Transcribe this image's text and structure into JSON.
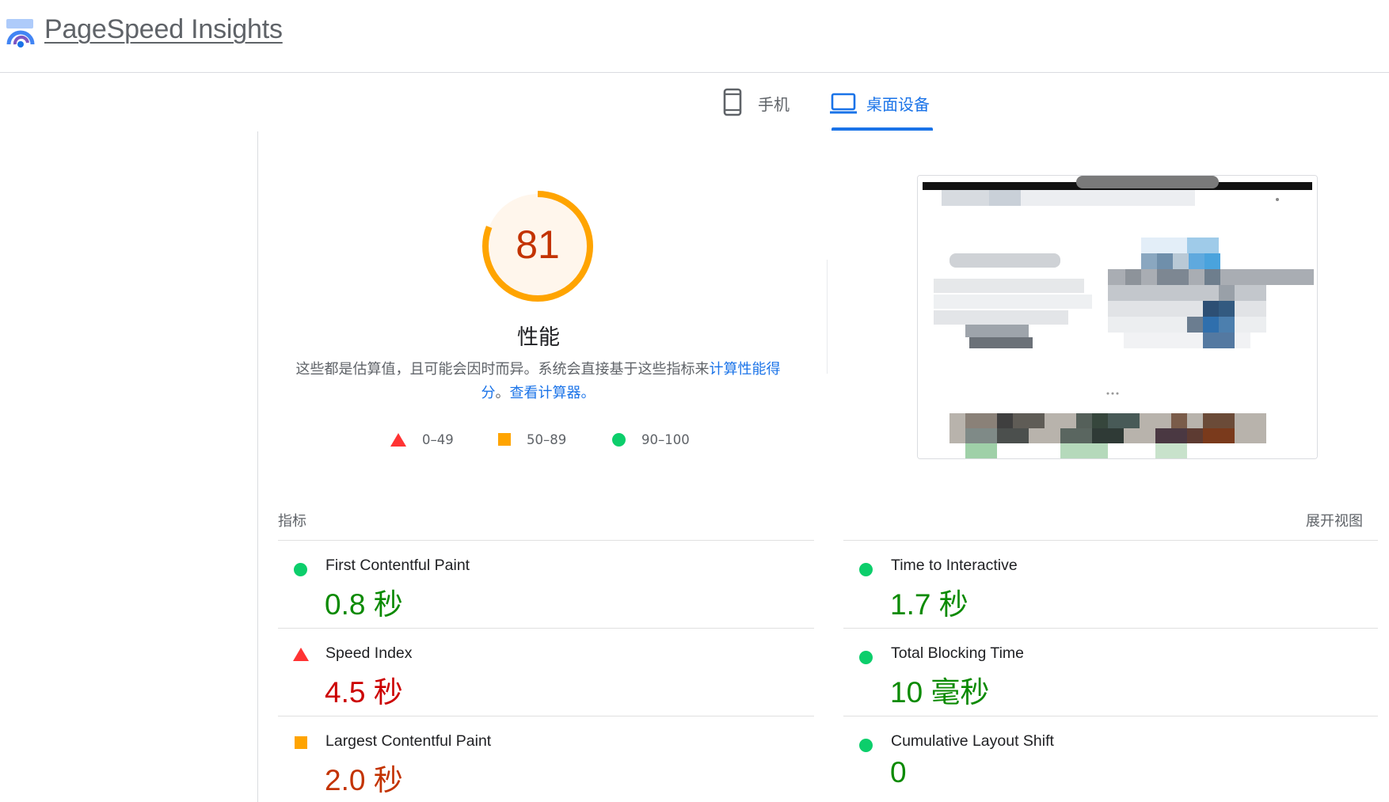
{
  "app": {
    "title": "PageSpeed Insights"
  },
  "tabs": [
    {
      "label": "手机",
      "icon": "smartphone-icon",
      "selected": false
    },
    {
      "label": "桌面设备",
      "icon": "laptop-icon",
      "selected": true
    }
  ],
  "summary": {
    "score": "81",
    "score_value": 0.81,
    "category": "性能",
    "description_text": "这些都是估算值，且可能会因时而异。系统会直接基于这些指标来",
    "description_link1": "计算性能得分",
    "description_separator": "。",
    "description_link2": "查看计算器。"
  },
  "legend": [
    {
      "icon": "triangle-icon",
      "label": "0–49"
    },
    {
      "icon": "square-icon",
      "label": "50–89"
    },
    {
      "icon": "circle-icon",
      "label": "90–100"
    }
  ],
  "metrics_section": {
    "heading": "指标",
    "expand_label": "展开视图"
  },
  "metrics": [
    {
      "name": "First Contentful Paint",
      "value": "0.8 秒",
      "rating": "good"
    },
    {
      "name": "Time to Interactive",
      "value": "1.7 秒",
      "rating": "good"
    },
    {
      "name": "Speed Index",
      "value": "4.5 秒",
      "rating": "bad"
    },
    {
      "name": "Total Blocking Time",
      "value": "10 毫秒",
      "rating": "good"
    },
    {
      "name": "Largest Contentful Paint",
      "value": "2.0 秒",
      "rating": "average"
    },
    {
      "name": "Cumulative Layout Shift",
      "value": "0",
      "rating": "good"
    }
  ],
  "colors": {
    "accent": "#1a73e8",
    "good": "#0cce6b",
    "average": "#ffa400",
    "bad": "#ff3333",
    "gauge_fill": "#fff3e0"
  }
}
